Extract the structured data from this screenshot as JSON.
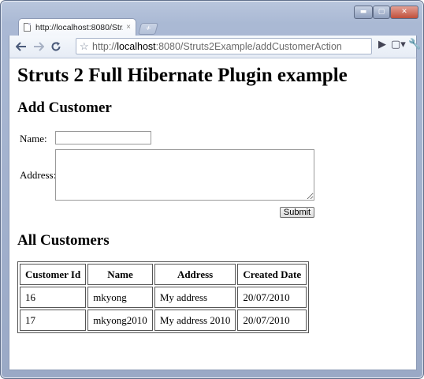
{
  "browser": {
    "tab_title": "http://localhost:8080/Str...",
    "tab_close": "×",
    "new_tab": "+",
    "address": {
      "prefix": "http://",
      "host": "localhost",
      "rest": ":8080/Struts2Example/addCustomerAction"
    },
    "window_controls": {
      "minimize": "▬",
      "maximize": "▢",
      "close": "✕"
    }
  },
  "page": {
    "title": "Struts 2 Full Hibernate Plugin example",
    "add_heading": "Add Customer",
    "form": {
      "name_label": "Name:",
      "name_value": "",
      "address_label": "Address:",
      "address_value": "",
      "submit_label": "Submit"
    },
    "all_heading": "All Customers",
    "table": {
      "headers": [
        "Customer Id",
        "Name",
        "Address",
        "Created Date"
      ],
      "rows": [
        [
          "16",
          "mkyong",
          "My address",
          "20/07/2010"
        ],
        [
          "17",
          "mkyong2010",
          "My address 2010",
          "20/07/2010"
        ]
      ]
    }
  },
  "icons": {
    "back": "back-arrow-icon",
    "forward": "forward-arrow-icon",
    "reload": "reload-icon",
    "star": "bookmark-star-icon",
    "go": "go-icon",
    "page_menu": "page-menu-icon",
    "wrench": "wrench-icon"
  }
}
